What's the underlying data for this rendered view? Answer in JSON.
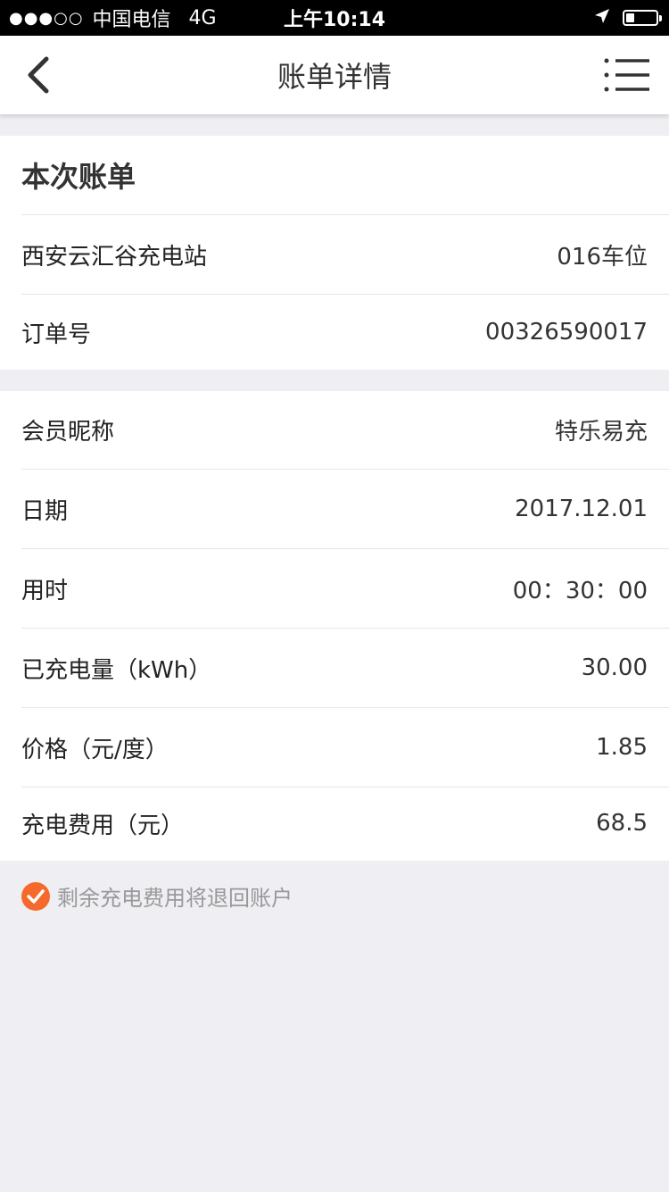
{
  "status_bar": {
    "signal": "●●●○○",
    "carrier": "中国电信",
    "network": "4G",
    "time": "上午10:14"
  },
  "nav": {
    "title": "账单详情"
  },
  "bill_section": {
    "heading": "本次账单",
    "rows": [
      {
        "label": "西安云汇谷充电站",
        "value": "016车位"
      },
      {
        "label": "订单号",
        "value": "00326590017"
      }
    ]
  },
  "detail_section": {
    "rows": [
      {
        "label": "会员昵称",
        "value": "特乐易充"
      },
      {
        "label": "日期",
        "value": "2017.12.01"
      },
      {
        "label": "用时",
        "value": "00：30：00"
      },
      {
        "label": "已充电量（kWh）",
        "value": "30.00"
      },
      {
        "label": "价格（元/度）",
        "value": "1.85"
      },
      {
        "label": "充电费用（元）",
        "value": "68.5"
      }
    ]
  },
  "notice": {
    "text": "剩余充电费用将退回账户"
  },
  "colors": {
    "accent": "#f56a2c",
    "page_background": "#efeef3"
  }
}
